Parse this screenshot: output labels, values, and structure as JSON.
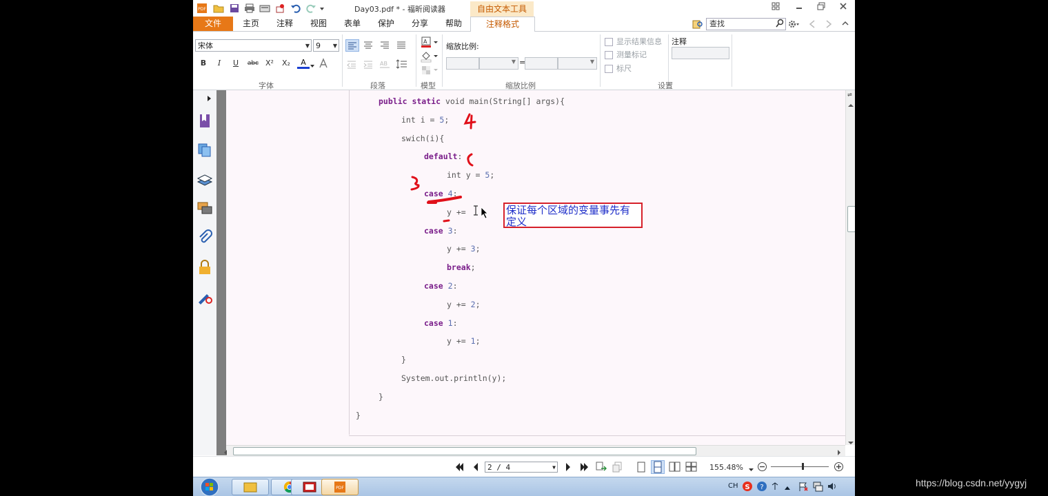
{
  "app": {
    "document_title": "Day03.pdf * - 福昕阅读器",
    "context_tool": "自由文本工具"
  },
  "tabs": [
    "文件",
    "主页",
    "注释",
    "视图",
    "表单",
    "保护",
    "分享",
    "帮助",
    "注释格式"
  ],
  "search": {
    "placeholder": "查找"
  },
  "ribbon": {
    "font_name": "宋体",
    "font_size": "9",
    "format_buttons": [
      "B",
      "I",
      "U",
      "abc",
      "X²",
      "X₂",
      "A"
    ],
    "scale_label": "缩放比例:",
    "equals": "=",
    "checkboxes": [
      "显示结果信息",
      "测量标记",
      "标尺"
    ],
    "comment_label": "注释",
    "groups": [
      "字体",
      "段落",
      "模型",
      "缩放比例",
      "设置"
    ]
  },
  "code_lines": [
    {
      "indent": 1,
      "parts": [
        [
          "kw",
          "public static "
        ],
        [
          "plain",
          "void main(String[] args){"
        ]
      ]
    },
    {
      "indent": 2,
      "parts": [
        [
          "plain",
          "int i = "
        ],
        [
          "num",
          "5"
        ],
        [
          "plain",
          ";"
        ]
      ]
    },
    {
      "indent": 2,
      "parts": [
        [
          "plain",
          "swich(i){"
        ]
      ]
    },
    {
      "indent": 3,
      "parts": [
        [
          "kw",
          "default"
        ],
        [
          "plain",
          ":"
        ]
      ]
    },
    {
      "indent": 4,
      "parts": [
        [
          "plain",
          "int y = "
        ],
        [
          "num",
          "5"
        ],
        [
          "plain",
          ";"
        ]
      ]
    },
    {
      "indent": 3,
      "parts": [
        [
          "kw",
          "case "
        ],
        [
          "num",
          "4"
        ],
        [
          "plain",
          ":"
        ]
      ]
    },
    {
      "indent": 4,
      "parts": [
        [
          "plain",
          "y += "
        ]
      ]
    },
    {
      "indent": 3,
      "parts": [
        [
          "kw",
          "case "
        ],
        [
          "num",
          "3"
        ],
        [
          "plain",
          ":"
        ]
      ]
    },
    {
      "indent": 4,
      "parts": [
        [
          "plain",
          "y += "
        ],
        [
          "num",
          "3"
        ],
        [
          "plain",
          ";"
        ]
      ]
    },
    {
      "indent": 4,
      "parts": [
        [
          "kw",
          "break"
        ],
        [
          "plain",
          ";"
        ]
      ]
    },
    {
      "indent": 3,
      "parts": [
        [
          "kw",
          "case "
        ],
        [
          "num",
          "2"
        ],
        [
          "plain",
          ":"
        ]
      ]
    },
    {
      "indent": 4,
      "parts": [
        [
          "plain",
          "y += "
        ],
        [
          "num",
          "2"
        ],
        [
          "plain",
          ";"
        ]
      ]
    },
    {
      "indent": 3,
      "parts": [
        [
          "kw",
          "case "
        ],
        [
          "num",
          "1"
        ],
        [
          "plain",
          ":"
        ]
      ]
    },
    {
      "indent": 4,
      "parts": [
        [
          "plain",
          "y += "
        ],
        [
          "num",
          "1"
        ],
        [
          "plain",
          ";"
        ]
      ]
    },
    {
      "indent": 2,
      "parts": [
        [
          "plain",
          "}"
        ]
      ]
    },
    {
      "indent": 2,
      "parts": [
        [
          "plain",
          "System.out.println(y);"
        ]
      ]
    },
    {
      "indent": 1,
      "parts": [
        [
          "plain",
          "}"
        ]
      ]
    },
    {
      "indent": 0,
      "parts": [
        [
          "plain",
          "}"
        ]
      ]
    }
  ],
  "annotations": {
    "callout_text": "保证每个区域的变量事先有定义",
    "handwritten_4": "4",
    "handwritten_open_brace": "{",
    "handwritten_close_brace": "}"
  },
  "status": {
    "page_indicator": "2 / 4",
    "zoom": "155.48%"
  },
  "taskbar": {
    "ime": "CH"
  },
  "watermark": "https://blog.csdn.net/yygyj",
  "colors": {
    "file_tab": "#e77817",
    "keyword": "#7a1e8a",
    "callout_border": "#d6202a",
    "callout_text": "#1f2fc9",
    "ink": "#e0101a"
  }
}
